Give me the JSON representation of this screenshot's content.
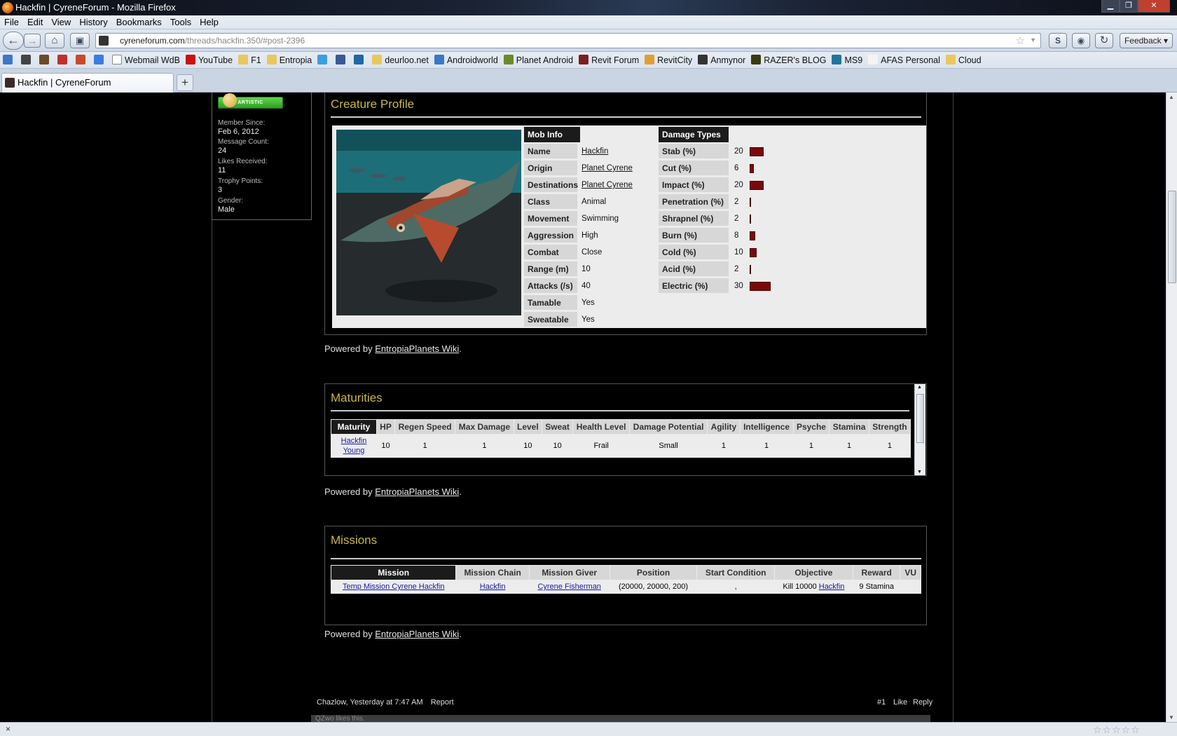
{
  "window": {
    "title": "Hackfin | CyreneForum - Mozilla Firefox"
  },
  "menu": [
    "File",
    "Edit",
    "View",
    "History",
    "Bookmarks",
    "Tools",
    "Help"
  ],
  "nav": {
    "url_host": "cyreneforum.com",
    "url_path": "/threads/hackfin.350/#post-2396",
    "feedback_label": "Feedback"
  },
  "bookmarks": [
    {
      "label": "",
      "icon": "globe-icon"
    },
    {
      "label": "",
      "icon": "printer-icon"
    },
    {
      "label": "",
      "icon": "owl-icon"
    },
    {
      "label": "",
      "icon": "tv-icon"
    },
    {
      "label": "",
      "icon": "bottle-icon"
    },
    {
      "label": "",
      "icon": "google-icon"
    },
    {
      "label": "Webmail WdB",
      "icon": "page-icon"
    },
    {
      "label": "YouTube",
      "icon": "youtube-icon"
    },
    {
      "label": "F1",
      "icon": "folder-icon"
    },
    {
      "label": "Entropia",
      "icon": "folder-icon"
    },
    {
      "label": "",
      "icon": "twitter-icon"
    },
    {
      "label": "",
      "icon": "facebook-icon"
    },
    {
      "label": "",
      "icon": "linkedin-icon"
    },
    {
      "label": "deurloo.net",
      "icon": "folder-icon"
    },
    {
      "label": "Androidworld",
      "icon": "globe-icon"
    },
    {
      "label": "Planet Android",
      "icon": "android-icon"
    },
    {
      "label": "Revit Forum",
      "icon": "revit-icon"
    },
    {
      "label": "RevitCity",
      "icon": "rc-icon"
    },
    {
      "label": "Anmynor",
      "icon": "a-icon"
    },
    {
      "label": "RAZER's BLOG",
      "icon": "razer-icon"
    },
    {
      "label": "MS9",
      "icon": "wordpress-icon"
    },
    {
      "label": "AFAS Personal",
      "icon": "circle-icon"
    },
    {
      "label": "Cloud",
      "icon": "folder-icon"
    }
  ],
  "tab": {
    "title": "Hackfin | CyreneForum"
  },
  "user": {
    "badge": "ARTISTIC",
    "member_since_label": "Member Since:",
    "member_since": "Feb 6, 2012",
    "message_count_label": "Message Count:",
    "message_count": "24",
    "likes_label": "Likes Received:",
    "likes": "11",
    "trophy_label": "Trophy Points:",
    "trophy": "3",
    "gender_label": "Gender:",
    "gender": "Male"
  },
  "creature_profile": {
    "title": "Creature Profile",
    "mob_info_header": "Mob Info",
    "mob_info": [
      {
        "label": "Name",
        "value": "Hackfin",
        "link": true
      },
      {
        "label": "Origin",
        "value": "Planet Cyrene",
        "link": true
      },
      {
        "label": "Destinations",
        "value": "Planet Cyrene",
        "link": true
      },
      {
        "label": "Class",
        "value": "Animal",
        "link": false
      },
      {
        "label": "Movement",
        "value": "Swimming",
        "link": false
      },
      {
        "label": "Aggression",
        "value": "High",
        "link": false
      },
      {
        "label": "Combat",
        "value": "Close",
        "link": false
      },
      {
        "label": "Range (m)",
        "value": "10",
        "link": false
      },
      {
        "label": "Attacks (/s)",
        "value": "40",
        "link": false
      },
      {
        "label": "Tamable",
        "value": "Yes",
        "link": false
      },
      {
        "label": "Sweatable",
        "value": "Yes",
        "link": false
      }
    ],
    "damage_header": "Damage Types",
    "damage_types": [
      {
        "label": "Stab (%)",
        "value": 20
      },
      {
        "label": "Cut (%)",
        "value": 6
      },
      {
        "label": "Impact (%)",
        "value": 20
      },
      {
        "label": "Penetration (%)",
        "value": 2
      },
      {
        "label": "Shrapnel (%)",
        "value": 2
      },
      {
        "label": "Burn (%)",
        "value": 8
      },
      {
        "label": "Cold (%)",
        "value": 10
      },
      {
        "label": "Acid (%)",
        "value": 2
      },
      {
        "label": "Electric (%)",
        "value": 30
      }
    ],
    "bar_color": "#7a0a0a"
  },
  "powered_by": {
    "prefix": "Powered by ",
    "link": "EntropiaPlanets Wiki",
    "suffix": "."
  },
  "maturities": {
    "title": "Maturities",
    "headers": [
      "Maturity",
      "HP",
      "Regen Speed",
      "Max Damage",
      "Level",
      "Sweat",
      "Health Level",
      "Damage Potential",
      "Agility",
      "Intelligence",
      "Psyche",
      "Stamina",
      "Strength"
    ],
    "rows": [
      [
        "Hackfin Young",
        "10",
        "1",
        "1",
        "10",
        "10",
        "Frail",
        "Small",
        "1",
        "1",
        "1",
        "1",
        "1"
      ]
    ]
  },
  "missions": {
    "title": "Missions",
    "headers": [
      "Mission",
      "Mission Chain",
      "Mission Giver",
      "Position",
      "Start Condition",
      "Objective",
      "Reward",
      "VU"
    ],
    "rows": [
      {
        "mission": "Temp Mission Cyrene Hackfin",
        "chain": "Hackfin",
        "giver": "Cyrene Fisherman",
        "position": "(20000, 20000, 200)",
        "start": ",",
        "objective_prefix": "Kill 10000 ",
        "objective_link": "Hackfin",
        "reward": "9 Stamina",
        "vu": ""
      }
    ]
  },
  "post": {
    "author_time": "Chazlow, Yesterday at 7:47 AM",
    "report": "Report",
    "number": "#1",
    "like": "Like",
    "reply": "Reply",
    "likes_bar": "QZwo likes this."
  },
  "status": {
    "close": "×"
  }
}
